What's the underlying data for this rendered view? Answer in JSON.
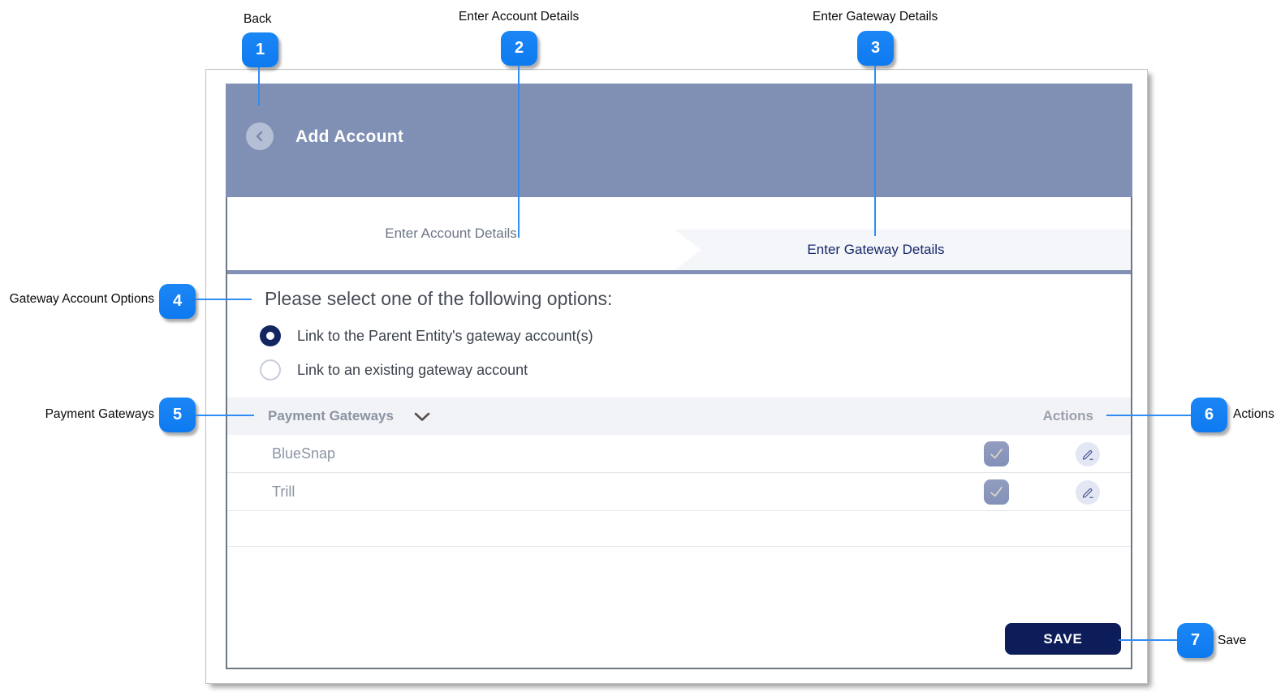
{
  "annotations": {
    "accent_color": "#1180f2",
    "line_color": "#2f8df3",
    "items": [
      {
        "num": "1",
        "label": "Back"
      },
      {
        "num": "2",
        "label": "Enter Account Details"
      },
      {
        "num": "3",
        "label": "Enter Gateway Details"
      },
      {
        "num": "4",
        "label": "Gateway Account Options"
      },
      {
        "num": "5",
        "label": "Payment Gateways"
      },
      {
        "num": "6",
        "label": "Actions"
      },
      {
        "num": "7",
        "label": "Save"
      }
    ]
  },
  "dialog": {
    "header": {
      "title": "Add Account",
      "back_icon": "chevron-left",
      "background_color": "#8090b4"
    },
    "tabs": [
      {
        "label": "Enter Account Details",
        "active": false
      },
      {
        "label": "Enter Gateway Details",
        "active": true
      }
    ],
    "options": {
      "prompt": "Please select one of the following options:",
      "radios": [
        {
          "label": "Link to the Parent Entity's gateway account(s)",
          "selected": true
        },
        {
          "label": "Link to an existing gateway account",
          "selected": false
        }
      ],
      "selected_color": "#13265f"
    },
    "gateway_table": {
      "header": "Payment Gateways",
      "header_icon": "chevron-down",
      "actions_header": "Actions",
      "rows": [
        {
          "name": "BlueSnap",
          "checked": true,
          "check_icon": "checkmark",
          "action_icon": "edit-pencil"
        },
        {
          "name": "Trill",
          "checked": true,
          "check_icon": "checkmark",
          "action_icon": "edit-pencil"
        }
      ]
    },
    "save_label": "SAVE",
    "save_color": "#0d1d5a"
  }
}
